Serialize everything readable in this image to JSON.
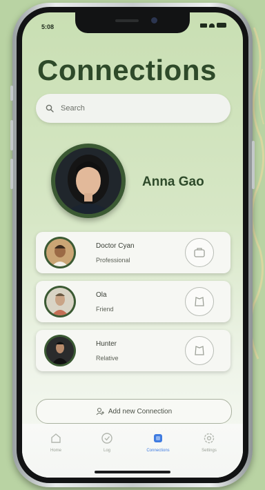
{
  "status": {
    "time": "5:08"
  },
  "page": {
    "title": "Connections"
  },
  "search": {
    "placeholder": "Search"
  },
  "profile": {
    "name": "Anna Gao"
  },
  "connections": [
    {
      "name": "Doctor Cyan",
      "relation": "Professional"
    },
    {
      "name": "Ola",
      "relation": "Friend"
    },
    {
      "name": "Hunter",
      "relation": "Relative"
    }
  ],
  "add_button": {
    "label": "Add new Connection"
  },
  "tabs": [
    {
      "label": "Home",
      "icon": "home-icon",
      "active": false
    },
    {
      "label": "Log",
      "icon": "log-icon",
      "active": false
    },
    {
      "label": "Connections",
      "icon": "connections-icon",
      "active": true
    },
    {
      "label": "Settings",
      "icon": "settings-icon",
      "active": false
    }
  ],
  "colors": {
    "accent": "#3f7be0",
    "title_green": "#2e4a2a",
    "background": "#b9d3a3"
  }
}
